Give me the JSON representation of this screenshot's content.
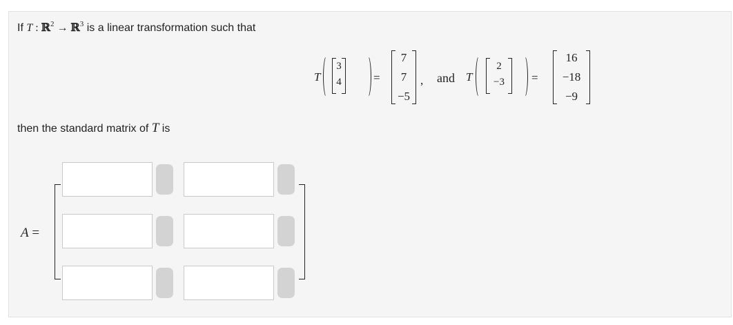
{
  "prompt": {
    "prefix": "If ",
    "T": "T",
    "colon": " : ",
    "R": "ℝ",
    "exp2": "2",
    "arrow": " → ",
    "exp3": "3",
    "suffix": " is a linear transformation such that"
  },
  "equation": {
    "T1": "T",
    "input1": [
      "3",
      "4"
    ],
    "eq1": "=",
    "output1": [
      "7",
      "7",
      "−5"
    ],
    "sep": ",",
    "and": "and",
    "T2": "T",
    "input2": [
      "2",
      "−3"
    ],
    "eq2": "=",
    "output2": [
      "16",
      "−18",
      "−9"
    ]
  },
  "question": {
    "prefix": "then the standard matrix of ",
    "T": "T",
    "suffix": " is"
  },
  "matrix": {
    "label_A": "A",
    "label_eq": " =",
    "cells": [
      [
        "",
        ""
      ],
      [
        "",
        ""
      ],
      [
        "",
        ""
      ]
    ]
  }
}
